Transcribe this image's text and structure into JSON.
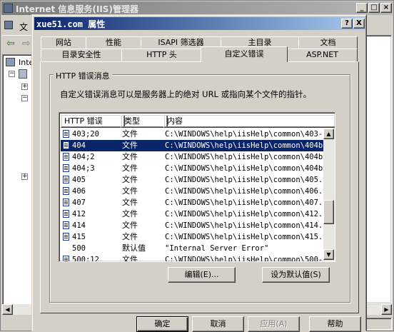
{
  "main_window": {
    "title": "Internet 信息服务(IIS)管理器",
    "menu_first": "文",
    "tree_root_label": "Inte",
    "status_fragment": "帮助"
  },
  "dialog": {
    "title": "xue51.com 属性",
    "help_glyph": "?",
    "close_glyph": "X",
    "tabs_back": [
      "网站",
      "性能",
      "ISAPI 筛选器",
      "主目录",
      "文档"
    ],
    "tabs_front": [
      "目录安全性",
      "HTTP 头",
      "自定义错误",
      "ASP.NET"
    ],
    "active_tab": "自定义错误",
    "group_title": "HTTP 错误消息",
    "description": "自定义错误消息可以是服务器上的绝对 URL 或指向某个文件的指针。",
    "list": {
      "headers": [
        "HTTP 错误",
        "类型",
        "内容"
      ],
      "rows": [
        {
          "code": "403;20",
          "type": "文件",
          "content": "C:\\WINDOWS\\help\\iisHelp\\common\\403-.",
          "icon": true,
          "selected": false
        },
        {
          "code": "404",
          "type": "文件",
          "content": "C:\\WINDOWS\\help\\iisHelp\\common\\404b.h",
          "icon": true,
          "selected": true
        },
        {
          "code": "404;2",
          "type": "文件",
          "content": "C:\\WINDOWS\\help\\iisHelp\\common\\404b.h",
          "icon": true,
          "selected": false
        },
        {
          "code": "404;3",
          "type": "文件",
          "content": "C:\\WINDOWS\\help\\iisHelp\\common\\404b.h",
          "icon": true,
          "selected": false
        },
        {
          "code": "405",
          "type": "文件",
          "content": "C:\\WINDOWS\\help\\iisHelp\\common\\405.ht",
          "icon": true,
          "selected": false
        },
        {
          "code": "406",
          "type": "文件",
          "content": "C:\\WINDOWS\\help\\iisHelp\\common\\406.ht",
          "icon": true,
          "selected": false
        },
        {
          "code": "407",
          "type": "文件",
          "content": "C:\\WINDOWS\\help\\iisHelp\\common\\407.ht",
          "icon": true,
          "selected": false
        },
        {
          "code": "412",
          "type": "文件",
          "content": "C:\\WINDOWS\\help\\iisHelp\\common\\412.ht",
          "icon": true,
          "selected": false
        },
        {
          "code": "414",
          "type": "文件",
          "content": "C:\\WINDOWS\\help\\iisHelp\\common\\414.ht",
          "icon": true,
          "selected": false
        },
        {
          "code": "415",
          "type": "文件",
          "content": "C:\\WINDOWS\\help\\iisHelp\\common\\415.ht",
          "icon": true,
          "selected": false
        },
        {
          "code": "500",
          "type": "默认值",
          "content": "\"Internal Server Error\"",
          "icon": false,
          "selected": false
        },
        {
          "code": "500;12",
          "type": "文件",
          "content": "C:\\WINDOWS\\help\\iisHelp\\common\\500-",
          "icon": true,
          "selected": false
        }
      ]
    },
    "edit_button": "编辑(E)...",
    "set_default_button": "设为默认值(S)",
    "ok_button": "确定",
    "cancel_button": "取消",
    "apply_button": "应用(A)",
    "help_button": "帮助"
  }
}
